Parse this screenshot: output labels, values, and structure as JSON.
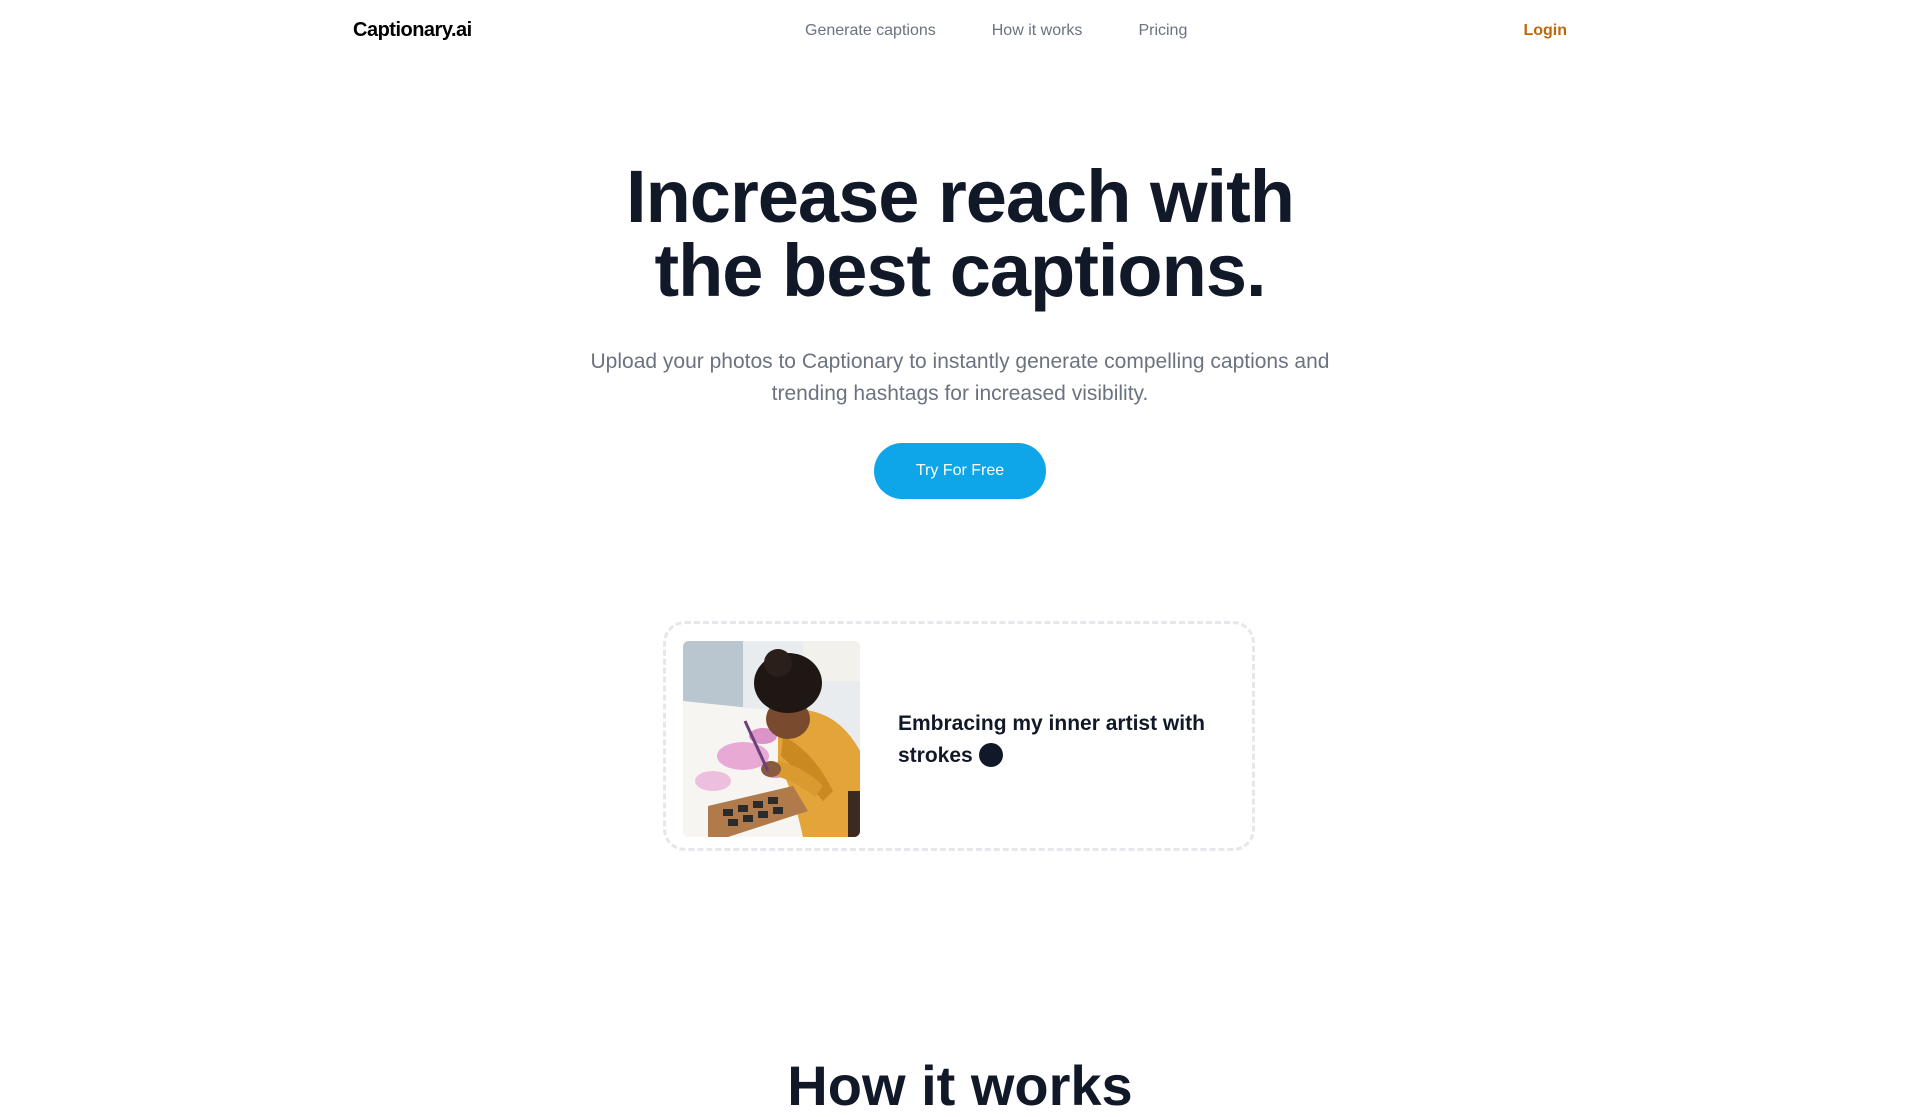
{
  "header": {
    "logo": "Captionary.ai",
    "nav": [
      {
        "label": "Generate captions"
      },
      {
        "label": "How it works"
      },
      {
        "label": "Pricing"
      }
    ],
    "login": "Login"
  },
  "hero": {
    "title_line1": "Increase reach with",
    "title_line2": "the best captions.",
    "subtitle": "Upload your photos to Captionary to instantly generate compelling captions and trending hashtags for increased visibility.",
    "cta": "Try For Free"
  },
  "example": {
    "caption": "Embracing my inner artist with strokes"
  },
  "section": {
    "heading": "How it works"
  },
  "colors": {
    "accent": "#0ea5e9",
    "login": "#c2660a",
    "heading": "#111827",
    "muted": "#6b7280"
  }
}
